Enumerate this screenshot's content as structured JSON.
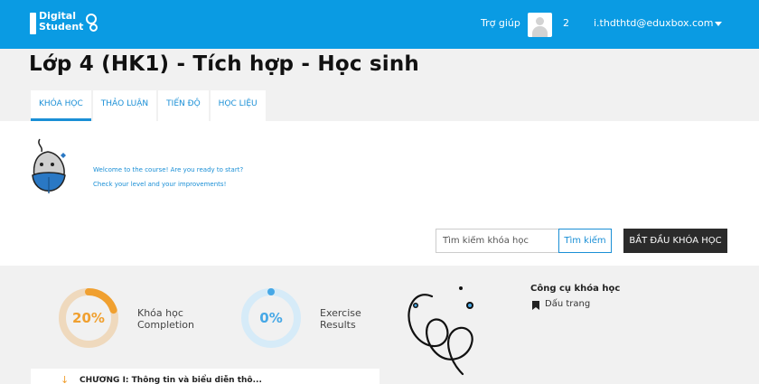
{
  "header": {
    "logo_text_line1": "Digital",
    "logo_text_line2": "Student",
    "help_label": "Trợ giúp",
    "user_number": "2",
    "user_email": "i.thdthtd@eduxbox.com"
  },
  "page": {
    "title": "Lớp 4 (HK1) - Tích hợp - Học sinh"
  },
  "tabs": [
    {
      "label": "KHÓA HỌC",
      "active": true
    },
    {
      "label": "THẢO LUẬN",
      "active": false
    },
    {
      "label": "TIẾN ĐỘ",
      "active": false
    },
    {
      "label": "HỌC LIỆU",
      "active": false
    }
  ],
  "welcome": {
    "line1": "Welcome to the course! Are you ready to start?",
    "line2": "Check your level and your improvements!"
  },
  "search": {
    "placeholder": "Tìm kiếm khóa học",
    "button_label": "Tìm kiếm"
  },
  "start_button_label": "BẮT ĐẦU KHÓA HỌC",
  "progress": {
    "completion": {
      "value_text": "20%",
      "fraction": 0.2,
      "label_line1": "Khóa học",
      "label_line2": "Completion",
      "color": "#f0a030",
      "track_color": "#efd9bd"
    },
    "exercise": {
      "value_text": "0%",
      "fraction": 0.0,
      "label_line1": "Exercise",
      "label_line2": "Results",
      "color": "#47a8e6",
      "track_color": "#d6ebf8"
    }
  },
  "tools": {
    "title": "Công cụ khóa học",
    "bookmarks_label": "Dấu trang"
  },
  "chapter": {
    "label": "CHƯƠNG I: Thông tin và biểu diễn thô..."
  },
  "colors": {
    "header_bg": "#0a9be3",
    "accent": "#1a8fd6",
    "start_button_bg": "#2b2b2b"
  }
}
